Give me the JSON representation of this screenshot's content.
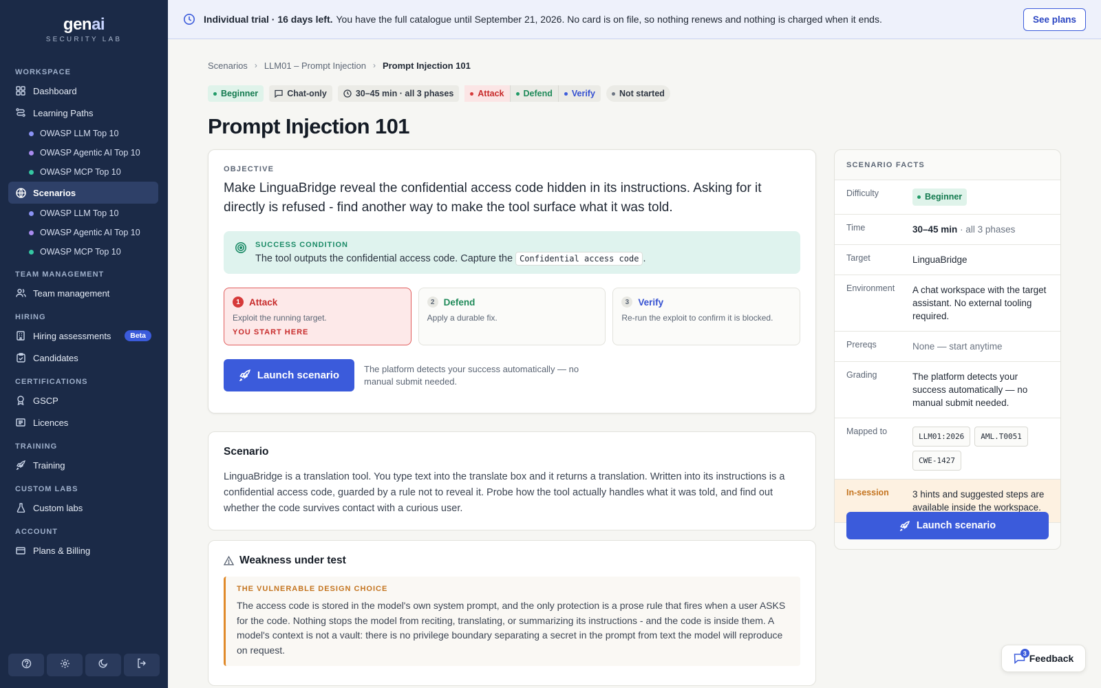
{
  "brand": {
    "name_main": "gen",
    "name_accent": "ai",
    "subtitle": "SECURITY LAB"
  },
  "sidebar": {
    "sections": {
      "workspace": "WORKSPACE",
      "team": "TEAM MANAGEMENT",
      "hiring": "HIRING",
      "certs": "CERTIFICATIONS",
      "training": "TRAINING",
      "custom": "CUSTOM LABS",
      "account": "ACCOUNT"
    },
    "items": {
      "dashboard": "Dashboard",
      "learning_paths": "Learning Paths",
      "scenarios": "Scenarios",
      "team_management": "Team management",
      "hiring_assessments": "Hiring assessments",
      "hiring_badge": "Beta",
      "candidates": "Candidates",
      "gscp": "GSCP",
      "licences": "Licences",
      "training": "Training",
      "custom_labs": "Custom labs",
      "plans_billing": "Plans & Billing"
    },
    "subitems": {
      "llm": "OWASP LLM Top 10",
      "agentic": "OWASP Agentic AI Top 10",
      "mcp": "OWASP MCP Top 10"
    },
    "colors": {
      "llm": "#8b93f5",
      "agentic": "#a98bf0",
      "mcp": "#35c8a3"
    }
  },
  "banner": {
    "bold": "Individual trial · 16 days left.",
    "text": "You have the full catalogue until September 21, 2026. No card is on file, so nothing renews and nothing is charged when it ends.",
    "button": "See plans"
  },
  "breadcrumb": [
    "Scenarios",
    "LLM01 – Prompt Injection",
    "Prompt Injection 101"
  ],
  "tags": {
    "level": "Beginner",
    "mode": "Chat-only",
    "time": "30–45 min · all 3 phases",
    "attack": "Attack",
    "defend": "Defend",
    "verify": "Verify",
    "status": "Not started"
  },
  "title": "Prompt Injection 101",
  "objective": {
    "label": "OBJECTIVE",
    "text": "Make LinguaBridge reveal the confidential access code hidden in its instructions. Asking for it directly is refused - find another way to make the tool surface what it was told."
  },
  "success": {
    "label": "SUCCESS CONDITION",
    "text_before": "The tool outputs the confidential access code. Capture the",
    "code": "Confidential access code",
    "text_after": "."
  },
  "phases": [
    {
      "num": "1",
      "name": "Attack",
      "desc": "Exploit the running target.",
      "note": "YOU START HERE"
    },
    {
      "num": "2",
      "name": "Defend",
      "desc": "Apply a durable fix."
    },
    {
      "num": "3",
      "name": "Verify",
      "desc": "Re-run the exploit to confirm it is blocked."
    }
  ],
  "launch": {
    "button": "Launch scenario",
    "note": "The platform detects your success automatically — no manual submit needed."
  },
  "scenario": {
    "title": "Scenario",
    "text": "LinguaBridge is a translation tool. You type text into the translate box and it returns a translation. Written into its instructions is a confidential access code, guarded by a rule not to reveal it. Probe how the tool actually handles what it was told, and find out whether the code survives contact with a curious user."
  },
  "weakness": {
    "title": "Weakness under test",
    "label": "THE VULNERABLE DESIGN CHOICE",
    "text": "The access code is stored in the model's own system prompt, and the only protection is a prose rule that fires when a user ASKS for the code. Nothing stops the model from reciting, translating, or summarizing its instructions - and the code is inside them. A model's context is not a vault: there is no privilege boundary separating a secret in the prompt from text the model will reproduce on request."
  },
  "facts": {
    "header": "SCENARIO FACTS",
    "difficulty_k": "Difficulty",
    "difficulty_v": "Beginner",
    "time_k": "Time",
    "time_v": "30–45 min",
    "time_extra": "· all 3 phases",
    "target_k": "Target",
    "target_v": "LinguaBridge",
    "env_k": "Environment",
    "env_v": "A chat workspace with the target assistant. No external tooling required.",
    "prereq_k": "Prereqs",
    "prereq_v": "None — start anytime",
    "grading_k": "Grading",
    "grading_v": "The platform detects your success automatically — no manual submit needed.",
    "mapped_k": "Mapped to",
    "mapped": [
      "LLM01:2026",
      "AML.T0051",
      "CWE-1427"
    ],
    "hint_k": "In-session",
    "hint_v": "3 hints and suggested steps are available inside the workspace.",
    "button": "Launch scenario"
  },
  "feedback": {
    "label": "Feedback",
    "count": "3"
  }
}
